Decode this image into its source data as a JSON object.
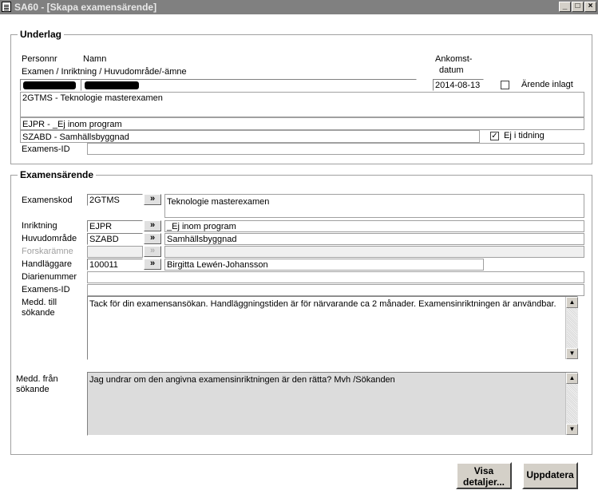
{
  "window": {
    "title": "SA60 - [Skapa examensärende]"
  },
  "underlag": {
    "legend": "Underlag",
    "labels": {
      "personnr": "Personnr",
      "namn": "Namn",
      "examen_inriktning": "Examen / Inriktning / Huvudområde/-ämne",
      "ankomst_line1": "Ankomst-",
      "ankomst_line2": "datum",
      "arende_inlagt": "Ärende inlagt",
      "ej_i_tidning": "Ej i tidning",
      "examens_id": "Examens-ID"
    },
    "ankomstdatum": "2014-08-13",
    "examen": "2GTMS - Teknologie masterexamen",
    "inriktning": "EJPR - _Ej inom program",
    "huvudomrade": "SZABD - Samhällsbyggnad",
    "examens_id": "",
    "arende_inlagt_checked": false,
    "ej_i_tidning_checked": true
  },
  "examensarende": {
    "legend": "Examensärende",
    "labels": {
      "examenskod": "Examenskod",
      "inriktning": "Inriktning",
      "huvudomrade": "Huvudområde",
      "forskaramne": "Forskarämne",
      "handlaggare": "Handläggare",
      "diarienummer": "Diarienummer",
      "examens_id": "Examens-ID",
      "medd_till_line1": "Medd. till",
      "medd_till_line2": "sökande",
      "medd_fran_line1": "Medd. från",
      "medd_fran_line2": "sökande"
    },
    "examenskod": "2GTMS",
    "examenskod_desc": "Teknologie masterexamen",
    "inriktning": "EJPR",
    "inriktning_desc": "_Ej inom program",
    "huvudomrade": "SZABD",
    "huvudomrade_desc": "Samhällsbyggnad",
    "forskaramne": "",
    "forskaramne_desc": "",
    "handlaggare": "100011",
    "handlaggare_desc": "Birgitta Lewén-Johansson",
    "diarienummer": "",
    "examens_id": "",
    "medd_till": "Tack för din examensansökan. Handläggningstiden är för närvarande ca 2 månader. Examensinriktningen är användbar.",
    "medd_fran": "Jag undrar om den angivna examensinriktningen är den rätta? Mvh /Sökanden"
  },
  "buttons": {
    "visa_line1": "Visa",
    "visa_line2": "detaljer...",
    "uppdatera": "Uppdatera",
    "lookup": "»"
  },
  "icons": {
    "app": "window-app-icon",
    "minimize": "_",
    "maximize": "□",
    "close": "×",
    "check": "✓",
    "scroll_up": "▲",
    "scroll_down": "▼"
  }
}
